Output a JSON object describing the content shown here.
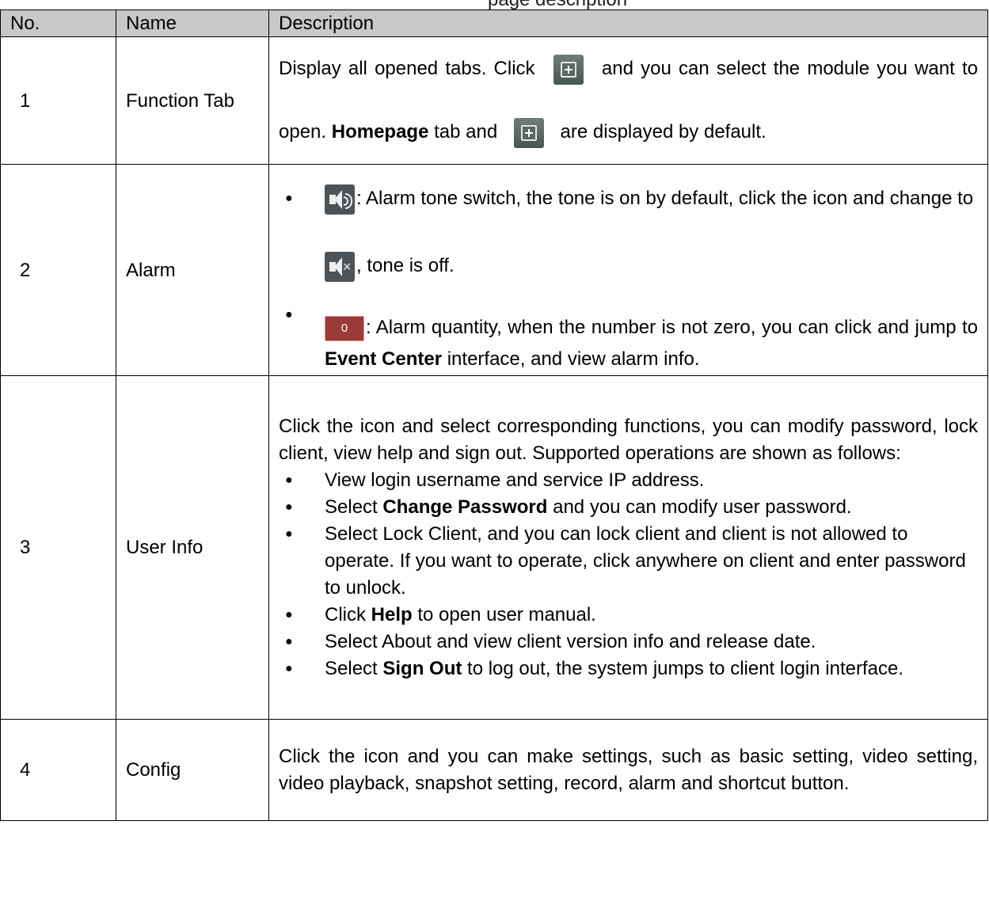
{
  "top_cut_text": "page description",
  "table": {
    "headers": {
      "no": "No.",
      "name": "Name",
      "description": "Description"
    },
    "rows": [
      {
        "no": "1",
        "name": "Function Tab",
        "description": {
          "part1": "Display all opened tabs. Click",
          "part2": "and you can select the module you want to open.",
          "bold": "Homepage",
          "part3": "tab and",
          "part4": "are displayed by default."
        }
      },
      {
        "no": "2",
        "name": "Alarm",
        "bullets": [
          {
            "text1": ": Alarm tone switch, the tone is on by default, click the icon and change to",
            "text2": ", tone is off."
          },
          {
            "text1": ": Alarm quantity, when the number is not zero, you can click and jump to",
            "bold": "Event Center",
            "text2": "interface, and view alarm info."
          }
        ],
        "badge_count": "0"
      },
      {
        "no": "3",
        "name": "User Info",
        "intro": "Click the icon and select corresponding functions, you can modify password, lock client, view help and sign out. Supported operations are shown as follows:",
        "bullets": [
          {
            "text1": "View login username and service IP address."
          },
          {
            "text1": "Select",
            "bold": "Change Password",
            "text2": "and you can modify user password."
          },
          {
            "text1": "Select Lock Client, and you can lock client and client is not allowed to operate. If you want to operate, click anywhere on client and enter password to unlock."
          },
          {
            "text1": "Click",
            "bold": "Help",
            "text2": "to open user manual."
          },
          {
            "text1": "Select About and view client version info and release date."
          },
          {
            "text1": "Select",
            "bold": "Sign Out",
            "text2": "to log out, the system jumps to client login interface."
          }
        ]
      },
      {
        "no": "4",
        "name": "Config",
        "description": "Click the icon and you can make settings, such as basic setting, video setting, video playback, snapshot setting, record, alarm and shortcut button."
      }
    ]
  },
  "icons": {
    "add_tab": "plus-square-icon",
    "tone_on": "speaker-on-icon",
    "tone_off": "speaker-muted-icon",
    "alarm_badge": "alarm-count-badge",
    "bullet": "bullet-dot-icon"
  },
  "colors": {
    "header_bg": "#c8c8c8",
    "badge_red": "#9b3a36",
    "icon_dark": "#4e5357"
  }
}
